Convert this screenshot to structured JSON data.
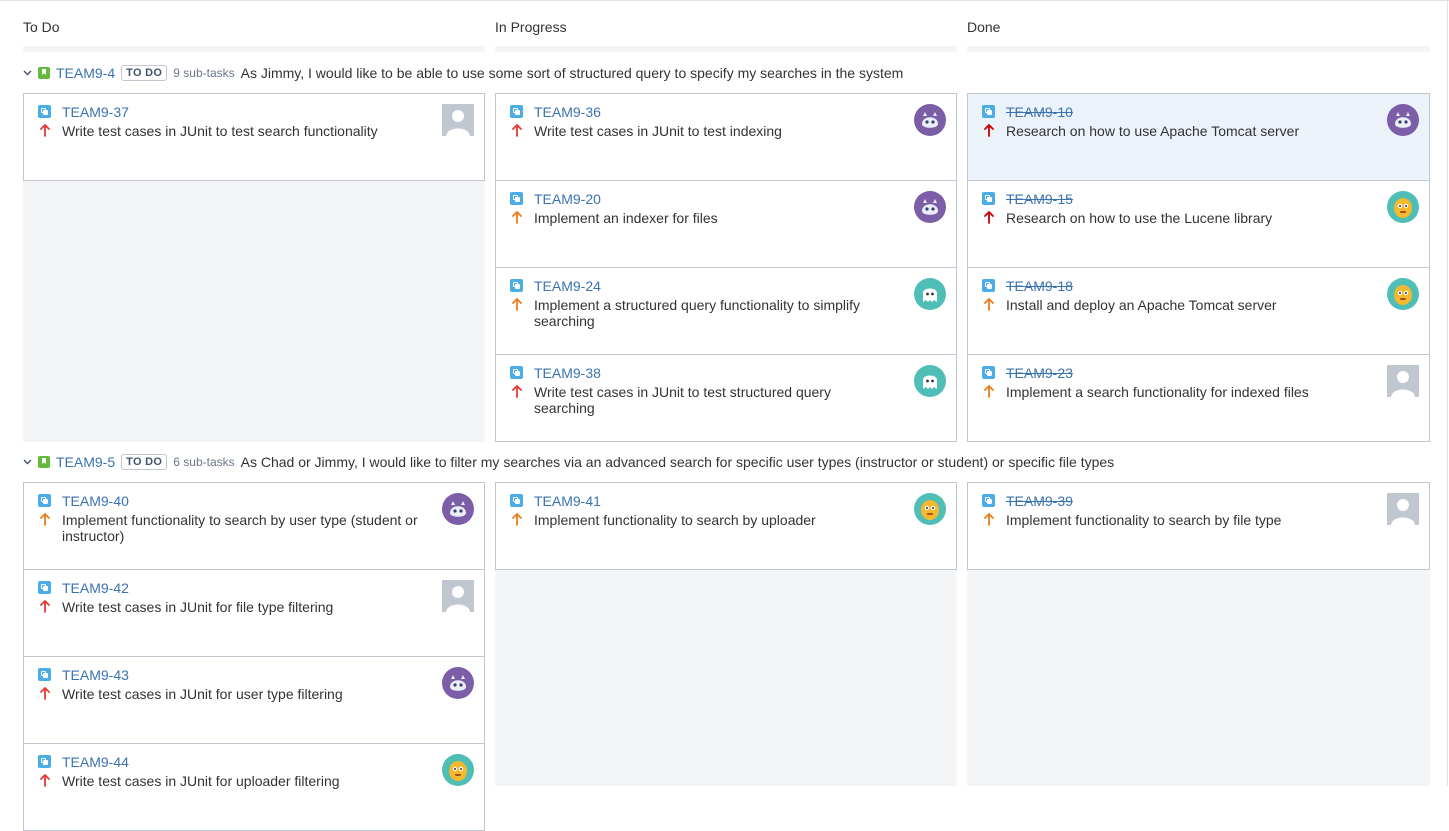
{
  "columns": [
    "To Do",
    "In Progress",
    "Done"
  ],
  "colors": {
    "link": "#3b73af",
    "story": "#63ba3c",
    "subtask": "#4bade8",
    "high": "#e53935",
    "medium": "#f07b1a",
    "highest": "#ce0000"
  },
  "swimlanes": [
    {
      "key": "TEAM9-4",
      "status": "TO DO",
      "subtasks": "9 sub-tasks",
      "summary": "As Jimmy, I would like to be able to use some sort of structured query to specify my searches in the system",
      "cards": {
        "todo": [
          {
            "key": "TEAM9-37",
            "summary": "Write test cases in JUnit to test search functionality",
            "priority": "high",
            "avatar": "default-avatar"
          }
        ],
        "inprogress": [
          {
            "key": "TEAM9-36",
            "summary": "Write test cases in JUnit to test indexing",
            "priority": "high",
            "avatar": "purple-avatar"
          },
          {
            "key": "TEAM9-20",
            "summary": "Implement an indexer for files",
            "priority": "medium",
            "avatar": "purple-avatar"
          },
          {
            "key": "TEAM9-24",
            "summary": "Implement a structured query functionality to simplify searching",
            "priority": "medium",
            "avatar": "teal-ghost-avatar"
          },
          {
            "key": "TEAM9-38",
            "summary": "Write test cases in JUnit to test structured query searching",
            "priority": "high",
            "avatar": "teal-ghost-avatar"
          }
        ],
        "done": [
          {
            "key": "TEAM9-10",
            "summary": "Research on how to use Apache Tomcat server",
            "priority": "highest",
            "avatar": "purple-avatar",
            "selected": true
          },
          {
            "key": "TEAM9-15",
            "summary": "Research on how to use the Lucene library",
            "priority": "highest",
            "avatar": "teal-yellow-avatar"
          },
          {
            "key": "TEAM9-18",
            "summary": "Install and deploy an Apache Tomcat server",
            "priority": "medium",
            "avatar": "teal-yellow-avatar"
          },
          {
            "key": "TEAM9-23",
            "summary": "Implement a search functionality for indexed files",
            "priority": "medium",
            "avatar": "default-avatar"
          }
        ]
      }
    },
    {
      "key": "TEAM9-5",
      "status": "TO DO",
      "subtasks": "6 sub-tasks",
      "summary": "As Chad or Jimmy, I would like to filter my searches via an advanced search for specific user types (instructor or student) or specific file types",
      "cards": {
        "todo": [
          {
            "key": "TEAM9-40",
            "summary": "Implement functionality to search by user type (student or instructor)",
            "priority": "medium",
            "avatar": "purple-avatar"
          },
          {
            "key": "TEAM9-42",
            "summary": "Write test cases in JUnit for file type filtering",
            "priority": "high",
            "avatar": "default-avatar"
          },
          {
            "key": "TEAM9-43",
            "summary": "Write test cases in JUnit for user type filtering",
            "priority": "high",
            "avatar": "purple-avatar"
          },
          {
            "key": "TEAM9-44",
            "summary": "Write test cases in JUnit for uploader filtering",
            "priority": "high",
            "avatar": "teal-yellow-avatar"
          }
        ],
        "inprogress": [
          {
            "key": "TEAM9-41",
            "summary": "Implement functionality to search by uploader",
            "priority": "medium",
            "avatar": "teal-yellow-avatar"
          }
        ],
        "done": [
          {
            "key": "TEAM9-39",
            "summary": "Implement functionality to search by file type",
            "priority": "medium",
            "avatar": "default-avatar"
          }
        ]
      }
    }
  ]
}
